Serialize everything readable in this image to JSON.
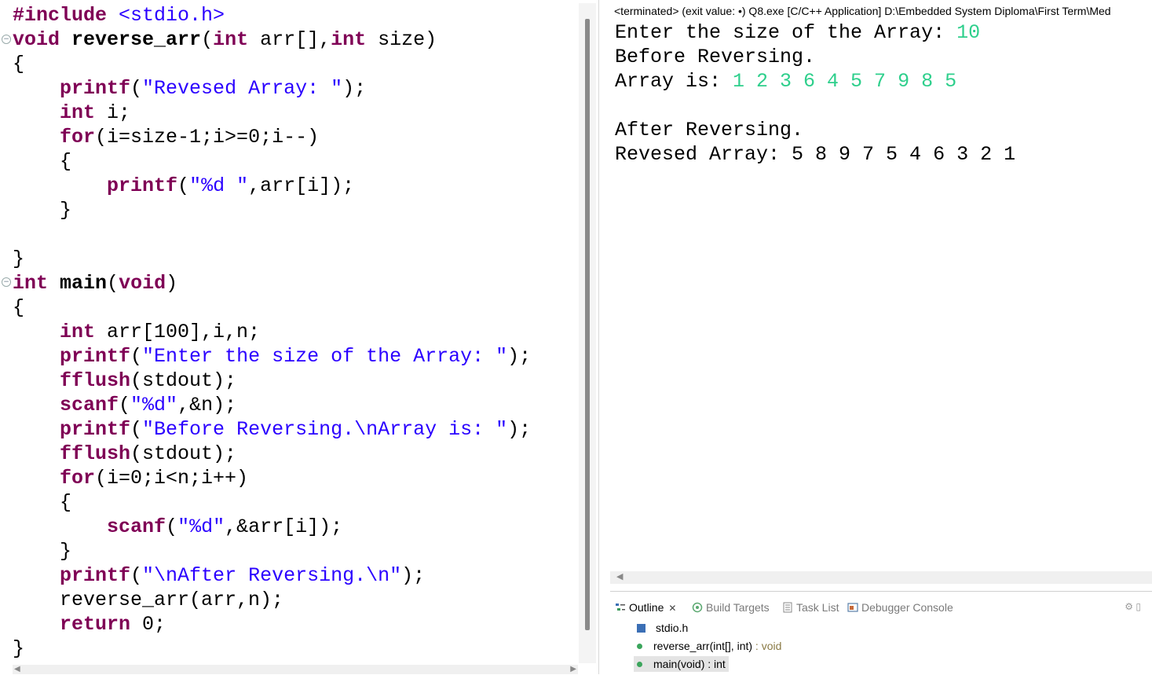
{
  "editor": {
    "lines": [
      [
        "#include ",
        "<stdio.h>"
      ],
      [
        "void",
        " ",
        "reverse_arr",
        "(",
        "int",
        " arr[],",
        "int",
        " size)"
      ],
      [
        "{"
      ],
      [
        "    ",
        "printf",
        "(",
        "\"Revesed Array: \"",
        ");"
      ],
      [
        "    ",
        "int",
        " i;"
      ],
      [
        "    ",
        "for",
        "(i=size-1;i>=0;i--)"
      ],
      [
        "    {"
      ],
      [
        "        ",
        "printf",
        "(",
        "\"%d \"",
        ",arr[i]);"
      ],
      [
        "    }"
      ],
      [
        ""
      ],
      [
        "}"
      ],
      [
        "int",
        " ",
        "main",
        "(",
        "void",
        ")"
      ],
      [
        "{"
      ],
      [
        "    ",
        "int",
        " arr[100],i,n;"
      ],
      [
        "    ",
        "printf",
        "(",
        "\"Enter the size of the Array: \"",
        ");"
      ],
      [
        "    ",
        "fflush",
        "(stdout);"
      ],
      [
        "    ",
        "scanf",
        "(",
        "\"%d\"",
        ",&n);"
      ],
      [
        "    ",
        "printf",
        "(",
        "\"Before Reversing.\\nArray is: \"",
        ");"
      ],
      [
        "    ",
        "fflush",
        "(stdout);"
      ],
      [
        "    ",
        "for",
        "(i=0;i<n;i++)"
      ],
      [
        "    {"
      ],
      [
        "        ",
        "scanf",
        "(",
        "\"%d\"",
        ",&arr[i]);"
      ],
      [
        "    }"
      ],
      [
        "    ",
        "printf",
        "(",
        "\"\\nAfter Reversing.\\n\"",
        ");"
      ],
      [
        "    reverse_arr(arr,n);"
      ],
      [
        "    ",
        "return",
        " 0;"
      ],
      [
        "}"
      ]
    ]
  },
  "console": {
    "header": "<terminated> (exit value: •) Q8.exe [C/C++ Application] D:\\Embedded System Diploma\\First Term\\Med",
    "line1_text": "Enter the size of the Array: ",
    "line1_input": "10",
    "line2_text": "Before Reversing.",
    "line3_text": "Array is: ",
    "line3_input": "1 2 3 6 4 5 7 9 8 5",
    "line5_text": "After Reversing.",
    "line6_text": "Revesed Array: 5 8 9 7 5 4 6 3 2 1"
  },
  "outline": {
    "tabs": {
      "outline": "Outline",
      "outline_close": "✕",
      "build_targets": "Build Targets",
      "task_list": "Task List",
      "debugger_console": "Debugger Console"
    },
    "items": {
      "include": "stdio.h",
      "reverse_sig": "reverse_arr(int[], int)",
      "reverse_ret": " : void",
      "main_sig": "main(void)",
      "main_ret": " : int"
    }
  },
  "colors": {
    "keyword": "#7f0055",
    "string": "#2a00ff",
    "console_input": "#2ecf8c"
  }
}
